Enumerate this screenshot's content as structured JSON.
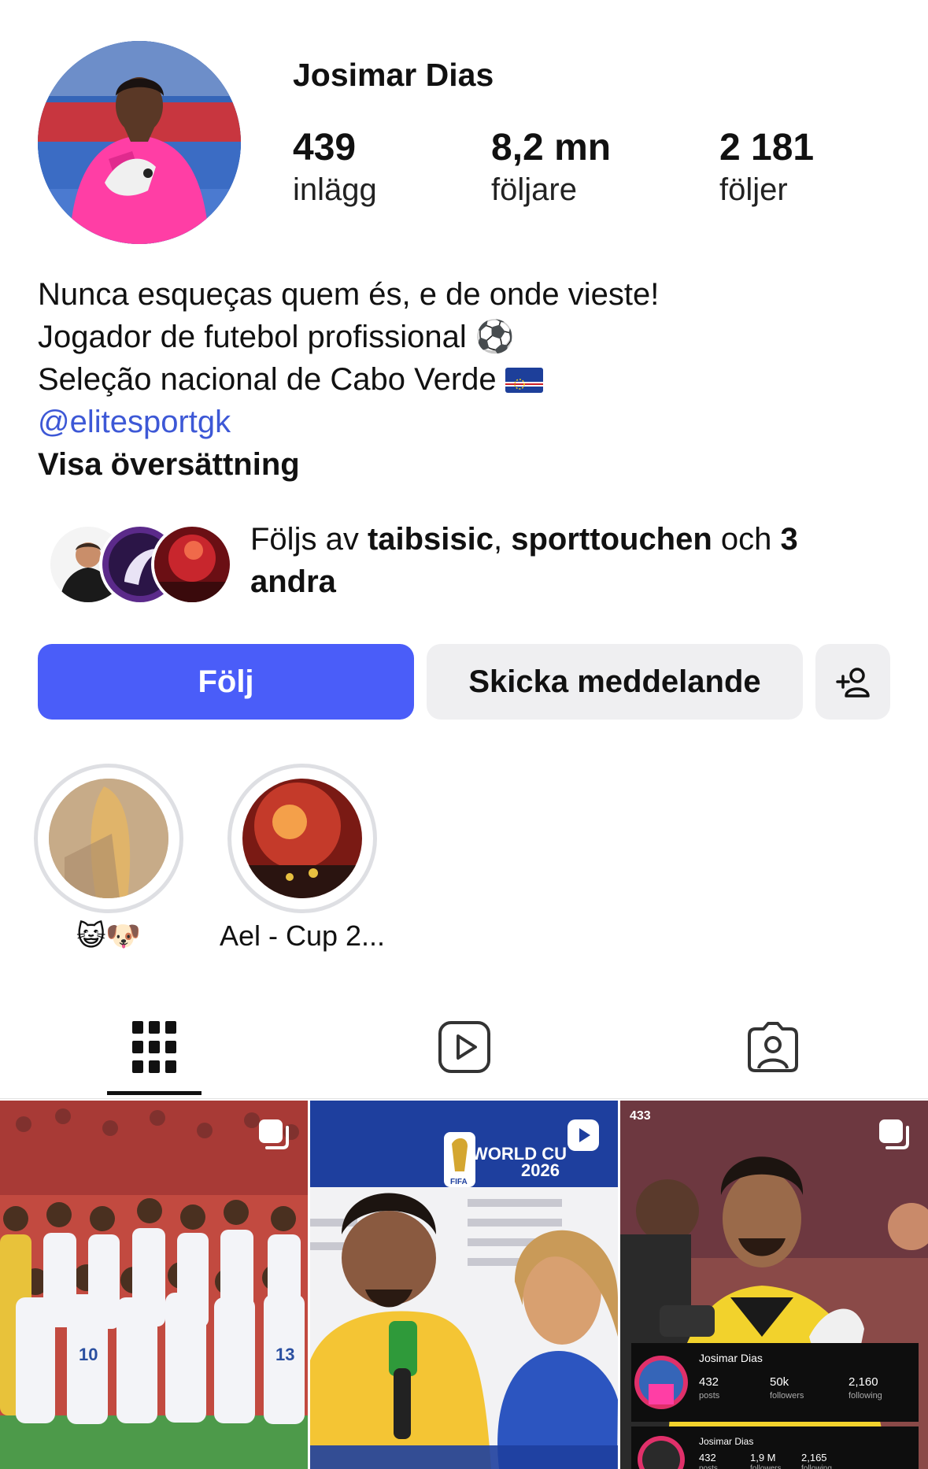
{
  "profile": {
    "name": "Josimar Dias",
    "stats": [
      {
        "value": "439",
        "label": "inlägg"
      },
      {
        "value": "8,2 mn",
        "label": "följare"
      },
      {
        "value": "2 181",
        "label": "följer"
      }
    ]
  },
  "bio": {
    "line1": "Nunca esqueças quem és, e de onde vieste!",
    "line2": "Jogador de futebol profissional ⚽",
    "line3": "Seleção nacional de Cabo Verde",
    "mention": "@elitesportgk",
    "translate": "Visa översättning"
  },
  "followed_by": {
    "prefix": "Följs av ",
    "user1": "taibsisic",
    "sep": ", ",
    "user2": "sporttouchen",
    "middle": " och ",
    "count": "3",
    "suffix": "andra"
  },
  "buttons": {
    "follow": "Följ",
    "message": "Skicka meddelande",
    "add_icon": "add-person-icon"
  },
  "highlights": [
    {
      "label": "😺🐶"
    },
    {
      "label": "Ael - Cup 2..."
    }
  ],
  "tabs": [
    {
      "icon": "grid-icon",
      "active": true
    },
    {
      "icon": "reels-icon",
      "active": false
    },
    {
      "icon": "tagged-icon",
      "active": false
    }
  ],
  "posts": [
    {
      "badge": "multi-post-icon"
    },
    {
      "badge": "reel-icon",
      "overlay_text": [
        "WORLD CU",
        "2026",
        "FIFA"
      ]
    },
    {
      "badge": "multi-post-icon",
      "overlay_text": [
        "433"
      ],
      "card1": {
        "name": "Josimar Dias",
        "posts": "432",
        "posts_label": "posts",
        "followers": "50k",
        "followers_label": "followers",
        "following": "2,160",
        "following_label": "following"
      },
      "card2": {
        "name": "Josimar Dias",
        "posts": "432",
        "posts_label": "posts",
        "followers": "1,9 M",
        "followers_label": "followers",
        "following": "2,165",
        "following_label": "following"
      }
    }
  ],
  "colors": {
    "accent": "#4a5df9",
    "mention": "#3d58d6",
    "button_secondary": "#efeff1"
  }
}
